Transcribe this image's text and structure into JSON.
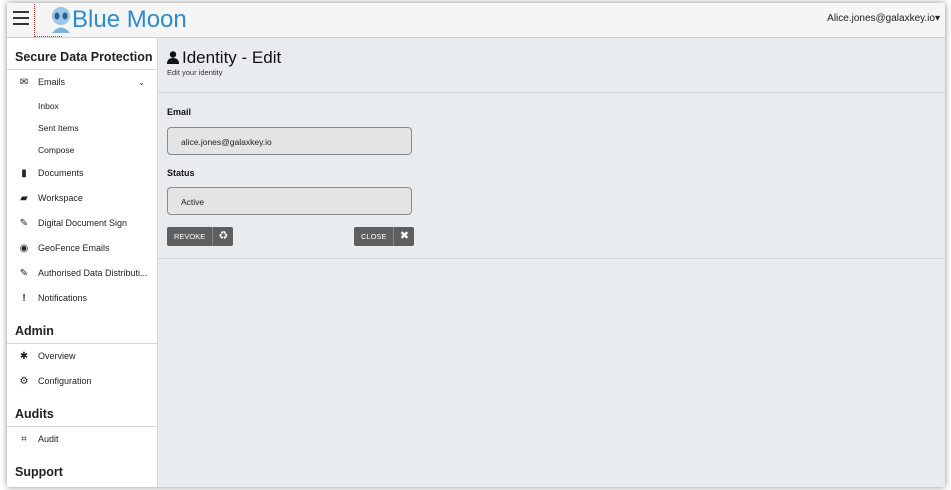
{
  "header": {
    "app_title": "Blue Moon",
    "user_email": "Alice.jones@galaxkey.io",
    "user_caret": "▾"
  },
  "sidebar": {
    "sections": [
      {
        "title": "Secure Data Protection"
      },
      {
        "title": "Admin"
      },
      {
        "title": "Audits"
      },
      {
        "title": "Support"
      }
    ],
    "emails": {
      "label": "Emails",
      "chevron": "⌄",
      "icon": "envelope-icon"
    },
    "email_subitems": [
      "Inbox",
      "Sent Items",
      "Compose"
    ],
    "sdp_items": [
      {
        "label": "Documents",
        "icon": "document-icon",
        "glyph": "▮"
      },
      {
        "label": "Workspace",
        "icon": "folder-open-icon",
        "glyph": "▰"
      },
      {
        "label": "Digital Document Sign",
        "icon": "pencil-icon",
        "glyph": "✎"
      },
      {
        "label": "GeoFence Emails",
        "icon": "globe-icon",
        "glyph": "◉"
      },
      {
        "label": "Authorised Data Distributi...",
        "icon": "pencil-icon",
        "glyph": "✎"
      },
      {
        "label": "Notifications",
        "icon": "exclamation-icon",
        "glyph": "!"
      }
    ],
    "admin_items": [
      {
        "label": "Overview",
        "icon": "gear-icon",
        "glyph": "✱"
      },
      {
        "label": "Configuration",
        "icon": "gears-icon",
        "glyph": "⚙"
      }
    ],
    "audit_items": [
      {
        "label": "Audit",
        "icon": "binoculars-icon",
        "glyph": "⌗"
      }
    ]
  },
  "main": {
    "title": "Identity - Edit",
    "subtitle": "Edit your identity",
    "email_label": "Email",
    "email_value": "alice.jones@galaxkey.io",
    "status_label": "Status",
    "status_value": "Active",
    "revoke_label": "REVOKE",
    "close_label": "CLOSE",
    "revoke_icon": "♻",
    "close_icon": "✖"
  }
}
